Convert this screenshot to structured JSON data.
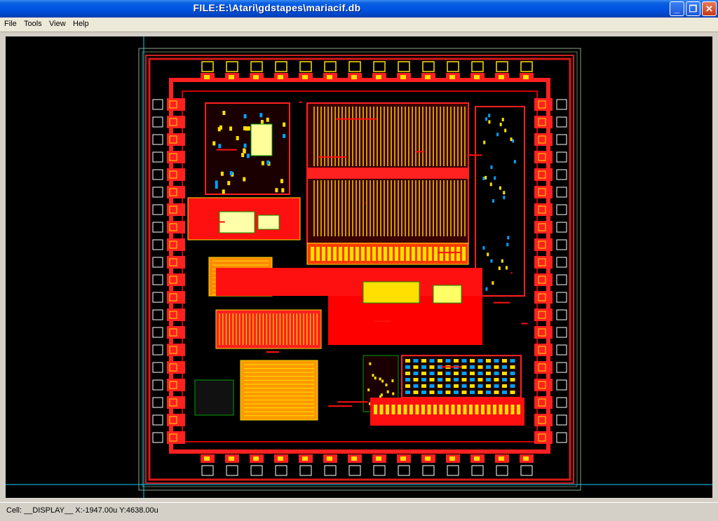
{
  "window": {
    "title": "FILE:E:\\Atari\\gdstapes\\mariacif.db"
  },
  "menu": {
    "items": [
      "File",
      "Tools",
      "View",
      "Help"
    ]
  },
  "status": {
    "cell_label": "Cell:",
    "cell_name": "__DISPLAY__",
    "x": "X:-1947.00u",
    "y": "Y:4638.00u"
  },
  "layout": {
    "description_free": true,
    "layer_colors": {
      "metal": "#ff1a1a",
      "poly": "#ffff00",
      "diffusion": "#00a000",
      "contact": "#1a1aff",
      "outline": "#ffffff",
      "cursor": "#00d0ff"
    }
  }
}
